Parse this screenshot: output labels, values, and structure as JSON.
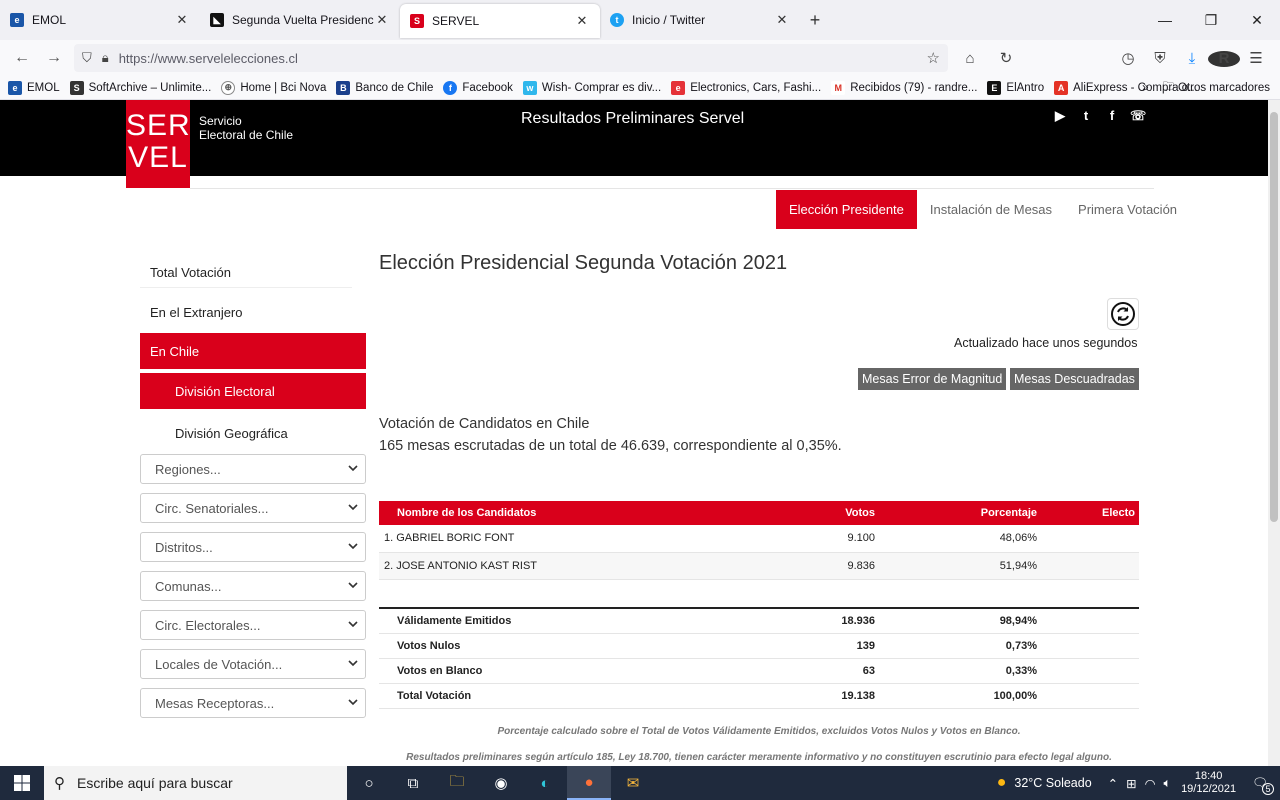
{
  "browser": {
    "tabs": [
      {
        "label": "EMOL",
        "color": "#1a56a8",
        "glyph": "e"
      },
      {
        "label": "Segunda Vuelta Presidencial Ch",
        "color": "#111",
        "glyph": "◣"
      },
      {
        "label": "SERVEL",
        "color": "#d9001b",
        "glyph": "S"
      },
      {
        "label": "Inicio / Twitter",
        "color": "#1da1f2",
        "glyph": "t"
      }
    ],
    "url": "https://www.servelelecciones.cl",
    "bookmarks": [
      {
        "label": "EMOL",
        "color": "#1a56a8",
        "glyph": "e"
      },
      {
        "label": "SoftArchive – Unlimite...",
        "color": "#333",
        "glyph": "S"
      },
      {
        "label": "Home | Bci Nova",
        "color": "#888",
        "glyph": "⊕"
      },
      {
        "label": "Banco de Chile",
        "color": "#1a3f8c",
        "glyph": "B"
      },
      {
        "label": "Facebook",
        "color": "#1877f2",
        "glyph": "f"
      },
      {
        "label": "Wish- Comprar es div...",
        "color": "#2fb7ec",
        "glyph": "w"
      },
      {
        "label": "Electronics, Cars, Fashi...",
        "color": "#e53238",
        "glyph": "e"
      },
      {
        "label": "Recibidos (79) - randre...",
        "color": "#d93025",
        "glyph": "M"
      },
      {
        "label": "ElAntro",
        "color": "#c00",
        "glyph": "E"
      },
      {
        "label": "AliExpress - Compra o...",
        "color": "#e43225",
        "glyph": "A"
      }
    ],
    "other_bookmarks": "Otros marcadores"
  },
  "header": {
    "logo_line1": "SER",
    "logo_line2": "VEL",
    "logo_caption_1": "Servicio",
    "logo_caption_2": "Electoral de Chile",
    "title": "Resultados Preliminares Servel"
  },
  "topnav": [
    "Elección Presidente",
    "Instalación de Mesas",
    "Primera Votación"
  ],
  "sidebar": {
    "items": [
      "Total Votación",
      "En el Extranjero",
      "En Chile",
      "División Electoral",
      "División Geográfica"
    ],
    "selects": [
      "Regiones...",
      "Circ. Senatoriales...",
      "Distritos...",
      "Comunas...",
      "Circ. Electorales...",
      "Locales de Votación...",
      "Mesas Receptoras..."
    ]
  },
  "main": {
    "title": "Elección Presidencial Segunda Votación 2021",
    "updated": "Actualizado hace unos segundos",
    "btn_error": "Mesas Error de Magnitud",
    "btn_descuadradas": "Mesas Descuadradas",
    "subtitle": "Votación de Candidatos en Chile",
    "summary": "165 mesas escrutadas de un total de 46.639, correspondiente al 0,35%.",
    "table_headers": [
      "Nombre de los Candidatos",
      "Votos",
      "Porcentaje",
      "Electo"
    ],
    "candidates": [
      {
        "name": "1. GABRIEL BORIC FONT",
        "votes": "9.100",
        "pct": "48,06%",
        "elected": ""
      },
      {
        "name": "2. JOSE ANTONIO KAST RIST",
        "votes": "9.836",
        "pct": "51,94%",
        "elected": ""
      }
    ],
    "totals": [
      {
        "name": "Válidamente Emitidos",
        "votes": "18.936",
        "pct": "98,94%"
      },
      {
        "name": "Votos Nulos",
        "votes": "139",
        "pct": "0,73%"
      },
      {
        "name": "Votos en Blanco",
        "votes": "63",
        "pct": "0,33%"
      },
      {
        "name": "Total Votación",
        "votes": "19.138",
        "pct": "100,00%"
      }
    ],
    "note1": "Porcentaje calculado sobre el Total de Votos Válidamente Emitidos, excluidos Votos Nulos y Votos en Blanco.",
    "note2": "Resultados preliminares según artículo 185, Ley 18.700, tienen carácter meramente informativo y no constituyen escrutinio para efecto legal alguno."
  },
  "taskbar": {
    "search_placeholder": "Escribe aquí para buscar",
    "weather": "32°C  Soleado",
    "time": "18:40",
    "date": "19/12/2021",
    "notif_count": "5"
  }
}
